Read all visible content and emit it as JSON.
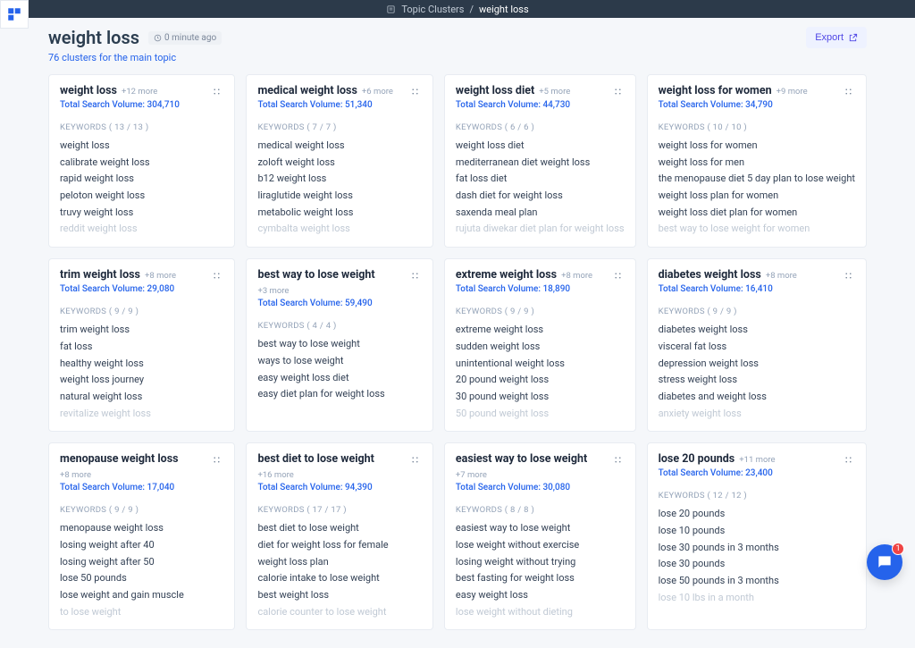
{
  "breadcrumb": {
    "parent": "Topic Clusters",
    "current": "weight loss"
  },
  "header": {
    "title": "weight loss",
    "timestamp": "0 minute ago",
    "subtitle": "76 clusters for the main topic",
    "export_label": "Export"
  },
  "chat": {
    "badge": "1"
  },
  "clusters": [
    {
      "title": "weight loss",
      "more": "+12 more",
      "volume": "Total Search Volume: 304,710",
      "kw_label": "KEYWORDS  ( 13 / 13 )",
      "keywords": [
        "weight loss",
        "calibrate weight loss",
        "rapid weight loss",
        "peloton weight loss",
        "truvy weight loss"
      ],
      "faded": "reddit weight loss"
    },
    {
      "title": "medical weight loss",
      "more": "+6 more",
      "volume": "Total Search Volume: 51,340",
      "kw_label": "KEYWORDS  ( 7 / 7 )",
      "keywords": [
        "medical weight loss",
        "zoloft weight loss",
        "b12 weight loss",
        "liraglutide weight loss",
        "metabolic weight loss"
      ],
      "faded": "cymbalta weight loss"
    },
    {
      "title": "weight loss diet",
      "more": "+5 more",
      "volume": "Total Search Volume: 44,730",
      "kw_label": "KEYWORDS  ( 6 / 6 )",
      "keywords": [
        "weight loss diet",
        "mediterranean diet weight loss",
        "fat loss diet",
        "dash diet for weight loss",
        "saxenda meal plan"
      ],
      "faded": "rujuta diwekar diet plan for weight loss"
    },
    {
      "title": "weight loss for women",
      "more": "+9 more",
      "volume": "Total Search Volume: 34,790",
      "kw_label": "KEYWORDS  ( 10 / 10 )",
      "keywords": [
        "weight loss for women",
        "weight loss for men",
        "the menopause diet 5 day plan to lose weight",
        "weight loss plan for women",
        "weight loss diet plan for women"
      ],
      "faded": "best way to lose weight for women"
    },
    {
      "title": "trim weight loss",
      "more": "+8 more",
      "volume": "Total Search Volume: 29,080",
      "kw_label": "KEYWORDS  ( 9 / 9 )",
      "keywords": [
        "trim weight loss",
        "fat loss",
        "healthy weight loss",
        "weight loss journey",
        "natural weight loss"
      ],
      "faded": "revitalize weight loss"
    },
    {
      "title": "best way to lose weight",
      "more": "+3 more",
      "volume": "Total Search Volume: 59,490",
      "kw_label": "KEYWORDS  ( 4 / 4 )",
      "keywords": [
        "best way to lose weight",
        "ways to lose weight",
        "easy weight loss diet",
        "easy diet plan for weight loss"
      ],
      "faded": ""
    },
    {
      "title": "extreme weight loss",
      "more": "+8 more",
      "volume": "Total Search Volume: 18,890",
      "kw_label": "KEYWORDS  ( 9 / 9 )",
      "keywords": [
        "extreme weight loss",
        "sudden weight loss",
        "unintentional weight loss",
        "20 pound weight loss",
        "30 pound weight loss"
      ],
      "faded": "50 pound weight loss"
    },
    {
      "title": "diabetes weight loss",
      "more": "+8 more",
      "volume": "Total Search Volume: 16,410",
      "kw_label": "KEYWORDS  ( 9 / 9 )",
      "keywords": [
        "diabetes weight loss",
        "visceral fat loss",
        "depression weight loss",
        "stress weight loss",
        "diabetes and weight loss"
      ],
      "faded": "anxiety weight loss"
    },
    {
      "title": "menopause weight loss",
      "more": "+8 more",
      "volume": "Total Search Volume: 17,040",
      "kw_label": "KEYWORDS  ( 9 / 9 )",
      "keywords": [
        "menopause weight loss",
        "losing weight after 40",
        "losing weight after 50",
        "lose 50 pounds",
        "lose weight and gain muscle"
      ],
      "faded": "to lose weight"
    },
    {
      "title": "best diet to lose weight",
      "more": "+16 more",
      "volume": "Total Search Volume: 94,390",
      "kw_label": "KEYWORDS  ( 17 / 17 )",
      "keywords": [
        "best diet to lose weight",
        "diet for weight loss for female",
        "weight loss plan",
        "calorie intake to lose weight",
        "best weight loss"
      ],
      "faded": "calorie counter to lose weight"
    },
    {
      "title": "easiest way to lose weight",
      "more": "+7 more",
      "volume": "Total Search Volume: 30,080",
      "kw_label": "KEYWORDS  ( 8 / 8 )",
      "keywords": [
        "easiest way to lose weight",
        "lose weight without exercise",
        "losing weight without trying",
        "best fasting for weight loss",
        "easy weight loss"
      ],
      "faded": "lose weight without dieting"
    },
    {
      "title": "lose 20 pounds",
      "more": "+11 more",
      "volume": "Total Search Volume: 23,400",
      "kw_label": "KEYWORDS  ( 12 / 12 )",
      "keywords": [
        "lose 20 pounds",
        "lose 10 pounds",
        "lose 30 pounds in 3 months",
        "lose 30 pounds",
        "lose 50 pounds in 3 months"
      ],
      "faded": "lose 10 lbs in a month"
    }
  ]
}
